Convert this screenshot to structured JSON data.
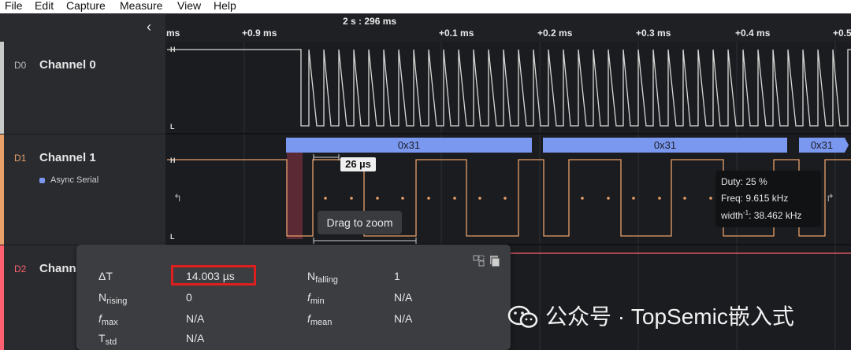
{
  "menu": [
    "File",
    "Edit",
    "Capture",
    "Measure",
    "View",
    "Help"
  ],
  "ruler": {
    "center_label": "2 s : 296 ms",
    "ticks": [
      "ms",
      "+0.9 ms",
      "+0.1 ms",
      "+0.2 ms",
      "+0.3 ms",
      "+0.4 ms",
      "+0.5"
    ]
  },
  "channels": [
    {
      "id": "D0",
      "name": "Channel 0",
      "color": "#c9c9c9"
    },
    {
      "id": "D1",
      "name": "Channel 1",
      "color": "#e8a06b",
      "analyzer": "Async Serial"
    },
    {
      "id": "D2",
      "name": "Channe",
      "color": "#ff5f6e"
    }
  ],
  "signal_levels": {
    "high": "H",
    "low": "L"
  },
  "decoded": [
    "0x31",
    "0x31",
    "0x31"
  ],
  "measure_label": "26 µs",
  "zoom_tip": "Drag to zoom",
  "tooltip": {
    "duty": "Duty: 25 %",
    "freq": "Freq: 9.615 kHz",
    "width_prefix": "width",
    "width_sup": "-1",
    "width_value": ": 38.462 kHz"
  },
  "measurements": {
    "delta_t": {
      "label": "ΔT",
      "value": "14.003 µs"
    },
    "n_falling": {
      "label": "N",
      "sub": "falling",
      "value": "1"
    },
    "n_rising": {
      "label": "N",
      "sub": "rising",
      "value": "0"
    },
    "f_min": {
      "label": "f",
      "sub": "min",
      "value": "N/A"
    },
    "f_max": {
      "label": "f",
      "sub": "max",
      "value": "N/A"
    },
    "f_mean": {
      "label": "f",
      "sub": "mean",
      "value": "N/A"
    },
    "t_std": {
      "label": "T",
      "sub": "std",
      "value": "N/A"
    }
  },
  "watermark": "公众号 · TopSemic嵌入式",
  "colors": {
    "decoder_blue": "#7a98f0",
    "highlight_red": "#e01e1e",
    "d1_orange": "#e8a06b"
  }
}
